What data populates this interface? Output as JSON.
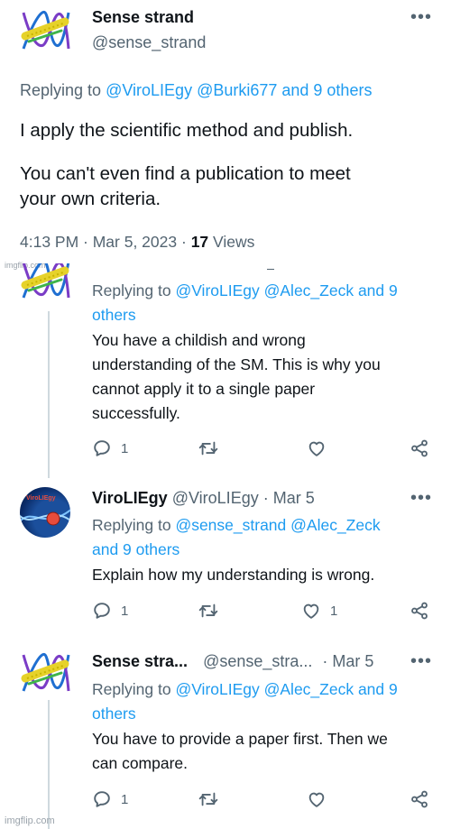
{
  "main_tweet": {
    "display_name": "Sense strand",
    "handle": "@sense_strand",
    "replying_prefix": "Replying to",
    "replying_handles": "@ViroLIEgy @Burki677 and 9 others",
    "body_line1": "I apply the scientific method and publish.",
    "body_line2": "You can't even find a publication to meet",
    "body_line3": "your own criteria.",
    "time": "4:13 PM · Mar 5, 2023 ·",
    "views_count": "17",
    "views_label": "Views"
  },
  "watermark_mid": "imgflip.com",
  "watermark_bottom": "imgflip.com",
  "replies": [
    {
      "replying_prefix": "Replying to",
      "replying_handles_line1": "@ViroLIEgy @Alec_Zeck and 9",
      "replying_handles_line2": "others",
      "body_line1": "You have a childish and wrong",
      "body_line2": "understanding of the SM. This is why you",
      "body_line3": "cannot apply it to a single paper",
      "body_line4": "successfully.",
      "reply_count": "1",
      "like_count": ""
    },
    {
      "display_name": "ViroLIEgy",
      "handle_date": "@ViroLIEgy · Mar 5",
      "avatar_text": "ViroLIEgy",
      "replying_prefix": "Replying to",
      "replying_handles_line1": "@sense_strand @Alec_Zeck",
      "replying_handles_line2": "and 9 others",
      "body_line1": "Explain how my understanding is wrong.",
      "reply_count": "1",
      "like_count": "1"
    },
    {
      "display_name": "Sense stra...",
      "handle": "@sense_stra...",
      "date": "· Mar 5",
      "replying_prefix": "Replying to",
      "replying_handles_line1": "@ViroLIEgy @Alec_Zeck and 9",
      "replying_handles_line2": "others",
      "body_line1": "You have to provide a paper first. Then we",
      "body_line2": "can compare.",
      "reply_count": "1",
      "like_count": ""
    }
  ],
  "icons": {
    "more": "more-icon",
    "reply": "reply-icon",
    "retweet": "retweet-icon",
    "like": "like-icon",
    "share": "share-icon"
  },
  "colors": {
    "link": "#1d9bf0",
    "muted": "#536471",
    "text": "#0f1419",
    "thread_line": "#cfd9de"
  }
}
